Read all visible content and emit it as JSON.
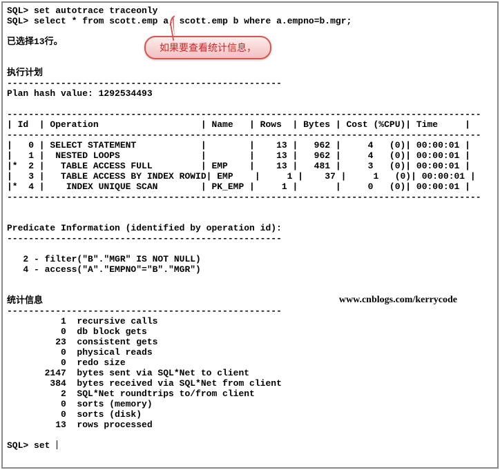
{
  "prompt": "SQL>",
  "cmd1": "set autotrace traceonly",
  "cmd2": "select * from scott.emp a, scott.emp b where a.empno=b.mgr;",
  "selected_rows_msg": "已选择13行。",
  "callout_text": "如果要查看统计信息，",
  "exec_plan_heading": "执行计划",
  "plan_hash_line": "Plan hash value: 1292534493",
  "plan_header": {
    "id": "Id",
    "op": "Operation",
    "name": "Name",
    "rows": "Rows",
    "bytes": "Bytes",
    "cost": "Cost (%CPU)",
    "time": "Time"
  },
  "plan_rows": [
    {
      "mark": " ",
      "id": "0",
      "op": "SELECT STATEMENT",
      "name": "",
      "rows": "13",
      "bytes": "962",
      "cost": "4",
      "cpu": "(0)",
      "time": "00:00:01"
    },
    {
      "mark": " ",
      "id": "1",
      "op": " NESTED LOOPS",
      "name": "",
      "rows": "13",
      "bytes": "962",
      "cost": "4",
      "cpu": "(0)",
      "time": "00:00:01"
    },
    {
      "mark": "*",
      "id": "2",
      "op": "  TABLE ACCESS FULL",
      "name": "EMP",
      "rows": "13",
      "bytes": "481",
      "cost": "3",
      "cpu": "(0)",
      "time": "00:00:01"
    },
    {
      "mark": " ",
      "id": "3",
      "op": "  TABLE ACCESS BY INDEX ROWID",
      "name": "EMP",
      "rows": "1",
      "bytes": "37",
      "cost": "1",
      "cpu": "(0)",
      "time": "00:00:01"
    },
    {
      "mark": "*",
      "id": "4",
      "op": "   INDEX UNIQUE SCAN",
      "name": "PK_EMP",
      "rows": "1",
      "bytes": "",
      "cost": "0",
      "cpu": "(0)",
      "time": "00:00:01"
    }
  ],
  "predicate_heading": "Predicate Information (identified by operation id):",
  "predicates": [
    "   2 - filter(\"B\".\"MGR\" IS NOT NULL)",
    "   4 - access(\"A\".\"EMPNO\"=\"B\".\"MGR\")"
  ],
  "watermark": "www.cnblogs.com/kerrycode",
  "stats_heading": "统计信息",
  "stats": [
    {
      "v": "1",
      "l": "recursive calls"
    },
    {
      "v": "0",
      "l": "db block gets"
    },
    {
      "v": "23",
      "l": "consistent gets"
    },
    {
      "v": "0",
      "l": "physical reads"
    },
    {
      "v": "0",
      "l": "redo size"
    },
    {
      "v": "2147",
      "l": "bytes sent via SQL*Net to client"
    },
    {
      "v": "384",
      "l": "bytes received via SQL*Net from client"
    },
    {
      "v": "2",
      "l": "SQL*Net roundtrips to/from client"
    },
    {
      "v": "0",
      "l": "sorts (memory)"
    },
    {
      "v": "0",
      "l": "sorts (disk)"
    },
    {
      "v": "13",
      "l": "rows processed"
    }
  ],
  "prompt2": "SQL>",
  "cmd3": "set",
  "hr": "----------------------------------------------------------------------------------------",
  "pred_hr": "---------------------------------------------------"
}
